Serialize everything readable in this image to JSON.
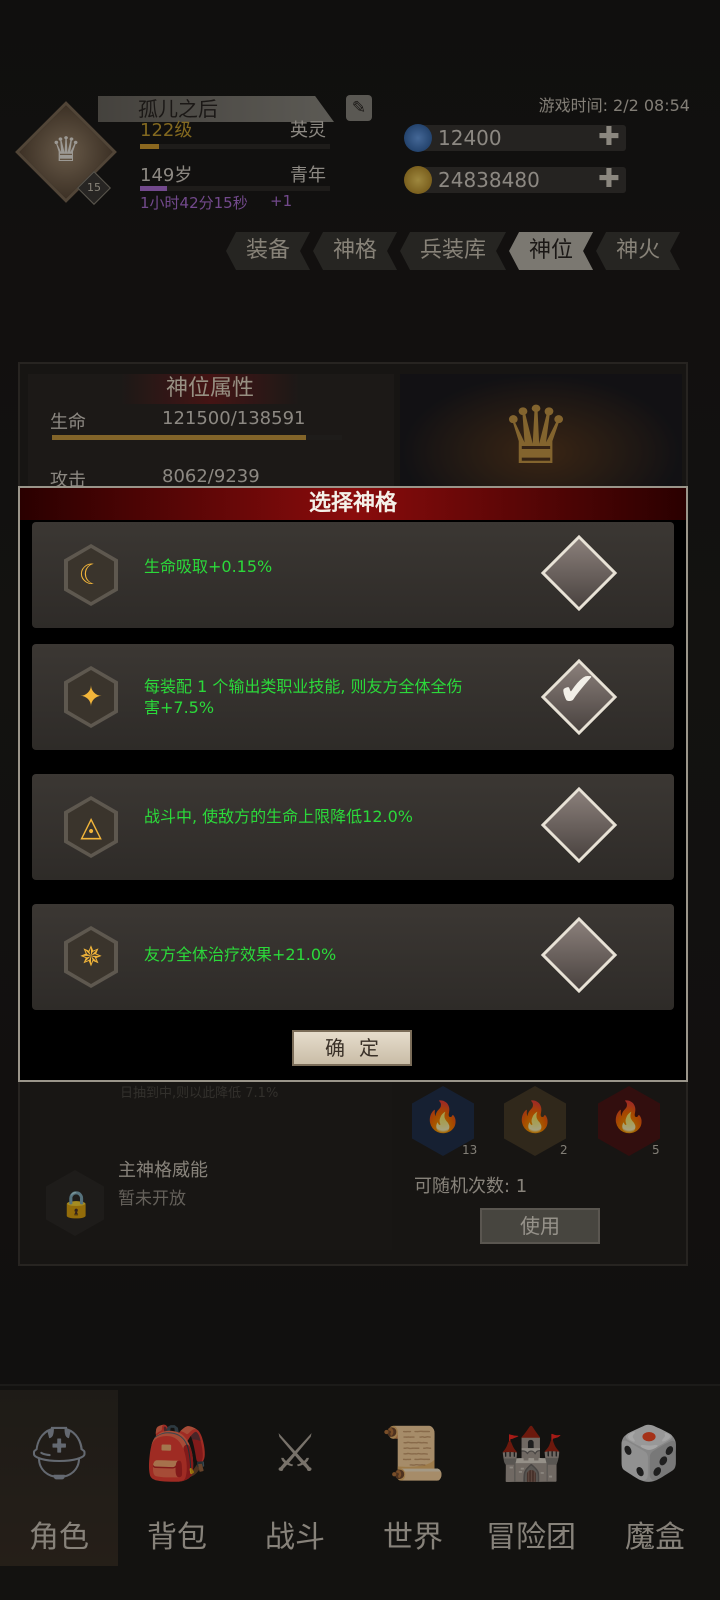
{
  "header": {
    "player_name": "孤儿之后",
    "avatar_level": "15",
    "level_text": "122级",
    "rank": "英灵",
    "age_text": "149岁",
    "life_stage": "青年",
    "timer_text": "1小时42分15秒",
    "timer_bonus": "+1",
    "game_time": "游戏时间: 2/2 08:54",
    "gems": "12400",
    "gold": "24838480"
  },
  "tabs": [
    {
      "label": "装备"
    },
    {
      "label": "神格"
    },
    {
      "label": "兵装库"
    },
    {
      "label": "神位"
    },
    {
      "label": "神火"
    }
  ],
  "attr_panel": {
    "title": "神位属性",
    "rows": [
      {
        "label": "生命",
        "value": "121500/138591",
        "ratio": 0.877
      },
      {
        "label": "攻击",
        "value": "8062/9239"
      }
    ]
  },
  "lower_panel": {
    "faded_text": "日抽到中,则以此降低 7.1%",
    "locked_title": "主神格威能",
    "locked_subtitle": "暂未开放",
    "flames": [
      {
        "count": "13",
        "color": "#3a5aa0"
      },
      {
        "count": "2",
        "color": "#6a5a3c"
      },
      {
        "count": "5",
        "color": "#8a1e1e"
      }
    ],
    "random_count": "可随机次数: 1",
    "use_label": "使用"
  },
  "modal": {
    "title": "选择神格",
    "options": [
      {
        "text": "生命吸取+0.15%",
        "icon": "moon-icon",
        "glyph": "☾",
        "selected": false
      },
      {
        "text": "每装配 1 个输出类职业技能, 则友方全体全伤害+7.5%",
        "icon": "sparkle-icon",
        "glyph": "✦",
        "selected": true
      },
      {
        "text": "战斗中, 使敌方的生命上限降低12.0%",
        "icon": "triangle-knot-icon",
        "glyph": "◬",
        "selected": false
      },
      {
        "text": "友方全体治疗效果+21.0%",
        "icon": "shuriken-icon",
        "glyph": "✵",
        "selected": false
      }
    ],
    "confirm_label": "确定"
  },
  "bottom_nav": [
    {
      "label": "角色",
      "icon": "helmet-icon",
      "glyph": "⛑",
      "active": true
    },
    {
      "label": "背包",
      "icon": "backpack-icon",
      "glyph": "🎒",
      "active": false
    },
    {
      "label": "战斗",
      "icon": "sword-shield-icon",
      "glyph": "⚔",
      "active": false
    },
    {
      "label": "世界",
      "icon": "scroll-icon",
      "glyph": "📜",
      "active": false
    },
    {
      "label": "冒险团",
      "icon": "castle-icon",
      "glyph": "🏰",
      "active": false
    },
    {
      "label": "魔盒",
      "icon": "magic-box-icon",
      "glyph": "🎲",
      "active": false
    }
  ],
  "colors": {
    "accent_red": "#8a0c0c",
    "option_text_green": "#2bd93a",
    "level_gold": "#c8a030",
    "timer_purple": "#b070d8"
  }
}
